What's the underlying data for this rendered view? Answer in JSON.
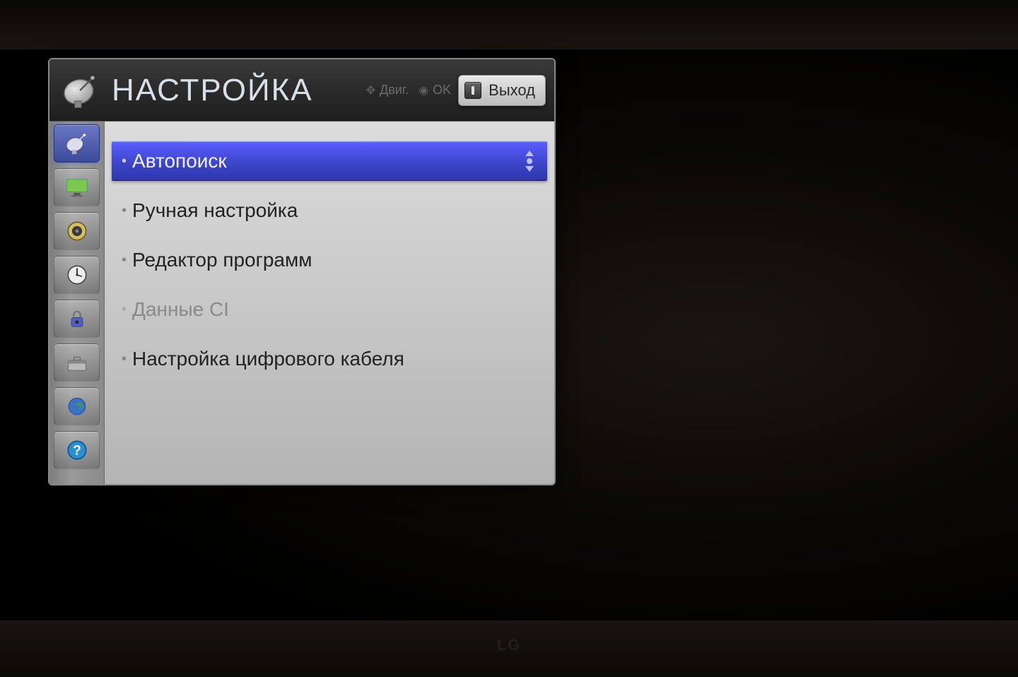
{
  "brand": "LG",
  "header": {
    "title": "НАСТРОЙКА",
    "hint_move": "Двиг.",
    "hint_ok": "OK",
    "exit_label": "Выход"
  },
  "sidebar": {
    "items": [
      {
        "name": "tuning",
        "icon": "satellite-dish-icon",
        "selected": true
      },
      {
        "name": "picture",
        "icon": "monitor-icon",
        "selected": false
      },
      {
        "name": "audio",
        "icon": "speaker-icon",
        "selected": false
      },
      {
        "name": "time",
        "icon": "clock-icon",
        "selected": false
      },
      {
        "name": "lock",
        "icon": "lock-icon",
        "selected": false
      },
      {
        "name": "option",
        "icon": "toolbox-icon",
        "selected": false
      },
      {
        "name": "network",
        "icon": "globe-icon",
        "selected": false
      },
      {
        "name": "support",
        "icon": "help-icon",
        "selected": false
      }
    ]
  },
  "menu": {
    "items": [
      {
        "label": "Автопоиск",
        "selected": true,
        "disabled": false
      },
      {
        "label": "Ручная настройка",
        "selected": false,
        "disabled": false
      },
      {
        "label": "Редактор программ",
        "selected": false,
        "disabled": false
      },
      {
        "label": "Данные CI",
        "selected": false,
        "disabled": true
      },
      {
        "label": "Настройка цифрового кабеля",
        "selected": false,
        "disabled": false
      }
    ]
  }
}
